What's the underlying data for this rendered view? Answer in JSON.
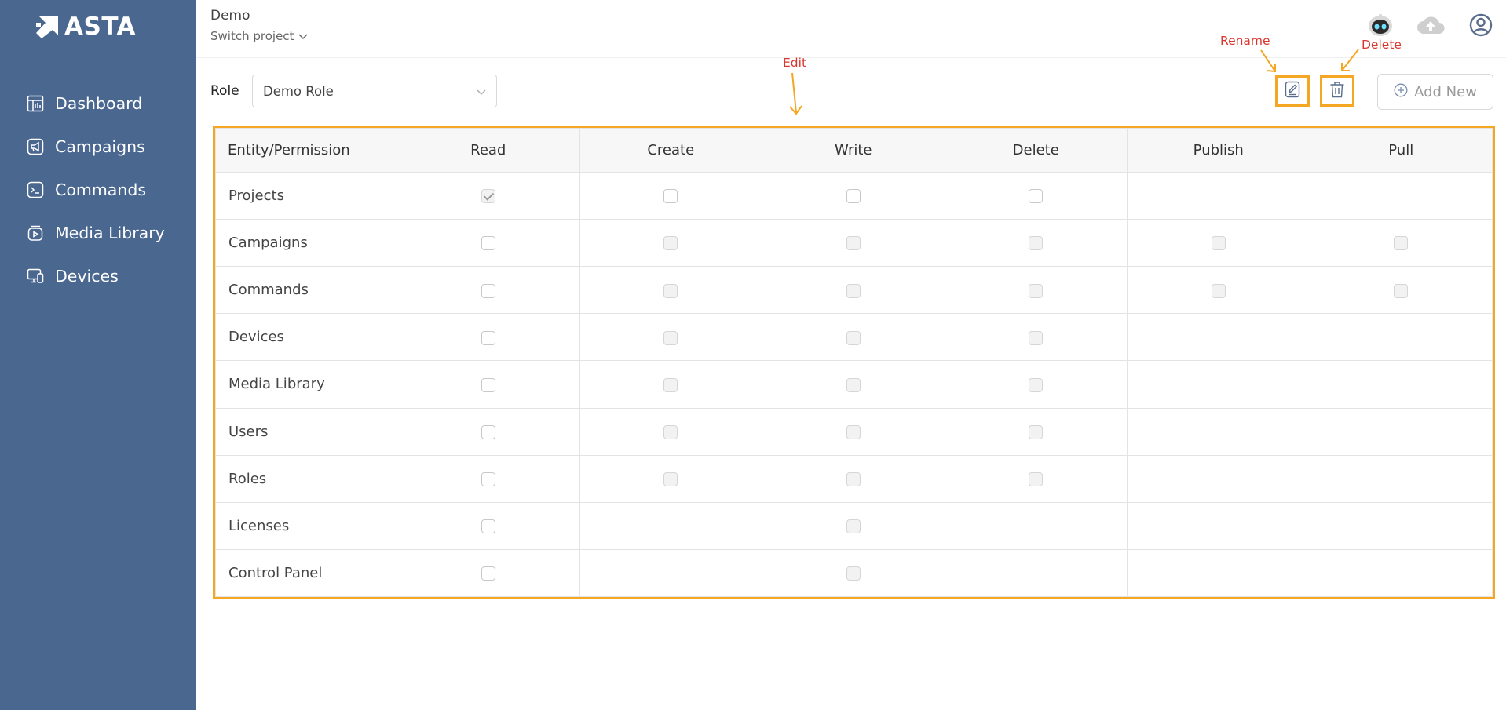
{
  "app": {
    "name": "ASTA"
  },
  "sidebar": {
    "items": [
      {
        "label": "Dashboard",
        "icon": "dashboard-icon"
      },
      {
        "label": "Campaigns",
        "icon": "campaigns-icon"
      },
      {
        "label": "Commands",
        "icon": "commands-icon"
      },
      {
        "label": "Media Library",
        "icon": "media-library-icon"
      },
      {
        "label": "Devices",
        "icon": "devices-icon"
      }
    ]
  },
  "header": {
    "project": "Demo",
    "switch_label": "Switch project"
  },
  "toolbar": {
    "role_label": "Role",
    "role_value": "Demo Role",
    "add_new_label": "Add New"
  },
  "annotations": {
    "rename": "Rename",
    "delete": "Delete",
    "edit": "Edit"
  },
  "table": {
    "columns": [
      "Entity/Permission",
      "Read",
      "Create",
      "Write",
      "Delete",
      "Publish",
      "Pull"
    ],
    "rows": [
      {
        "entity": "Projects",
        "cells": [
          "checked",
          "enabled",
          "enabled",
          "enabled",
          "none",
          "none"
        ]
      },
      {
        "entity": "Campaigns",
        "cells": [
          "enabled",
          "disabled",
          "disabled",
          "disabled",
          "disabled",
          "disabled"
        ]
      },
      {
        "entity": "Commands",
        "cells": [
          "enabled",
          "disabled",
          "disabled",
          "disabled",
          "disabled",
          "disabled"
        ]
      },
      {
        "entity": "Devices",
        "cells": [
          "enabled",
          "disabled",
          "disabled",
          "disabled",
          "none",
          "none"
        ]
      },
      {
        "entity": "Media Library",
        "cells": [
          "enabled",
          "disabled",
          "disabled",
          "disabled",
          "none",
          "none"
        ]
      },
      {
        "entity": "Users",
        "cells": [
          "enabled",
          "disabled",
          "disabled",
          "disabled",
          "none",
          "none"
        ]
      },
      {
        "entity": "Roles",
        "cells": [
          "enabled",
          "disabled",
          "disabled",
          "disabled",
          "none",
          "none"
        ]
      },
      {
        "entity": "Licenses",
        "cells": [
          "enabled",
          "none",
          "disabled",
          "none",
          "none",
          "none"
        ]
      },
      {
        "entity": "Control Panel",
        "cells": [
          "enabled",
          "none",
          "disabled",
          "none",
          "none",
          "none"
        ]
      }
    ]
  },
  "colors": {
    "sidebar_bg": "#4a6790",
    "highlight": "#f5a623",
    "annotation_text": "#d9362f"
  }
}
